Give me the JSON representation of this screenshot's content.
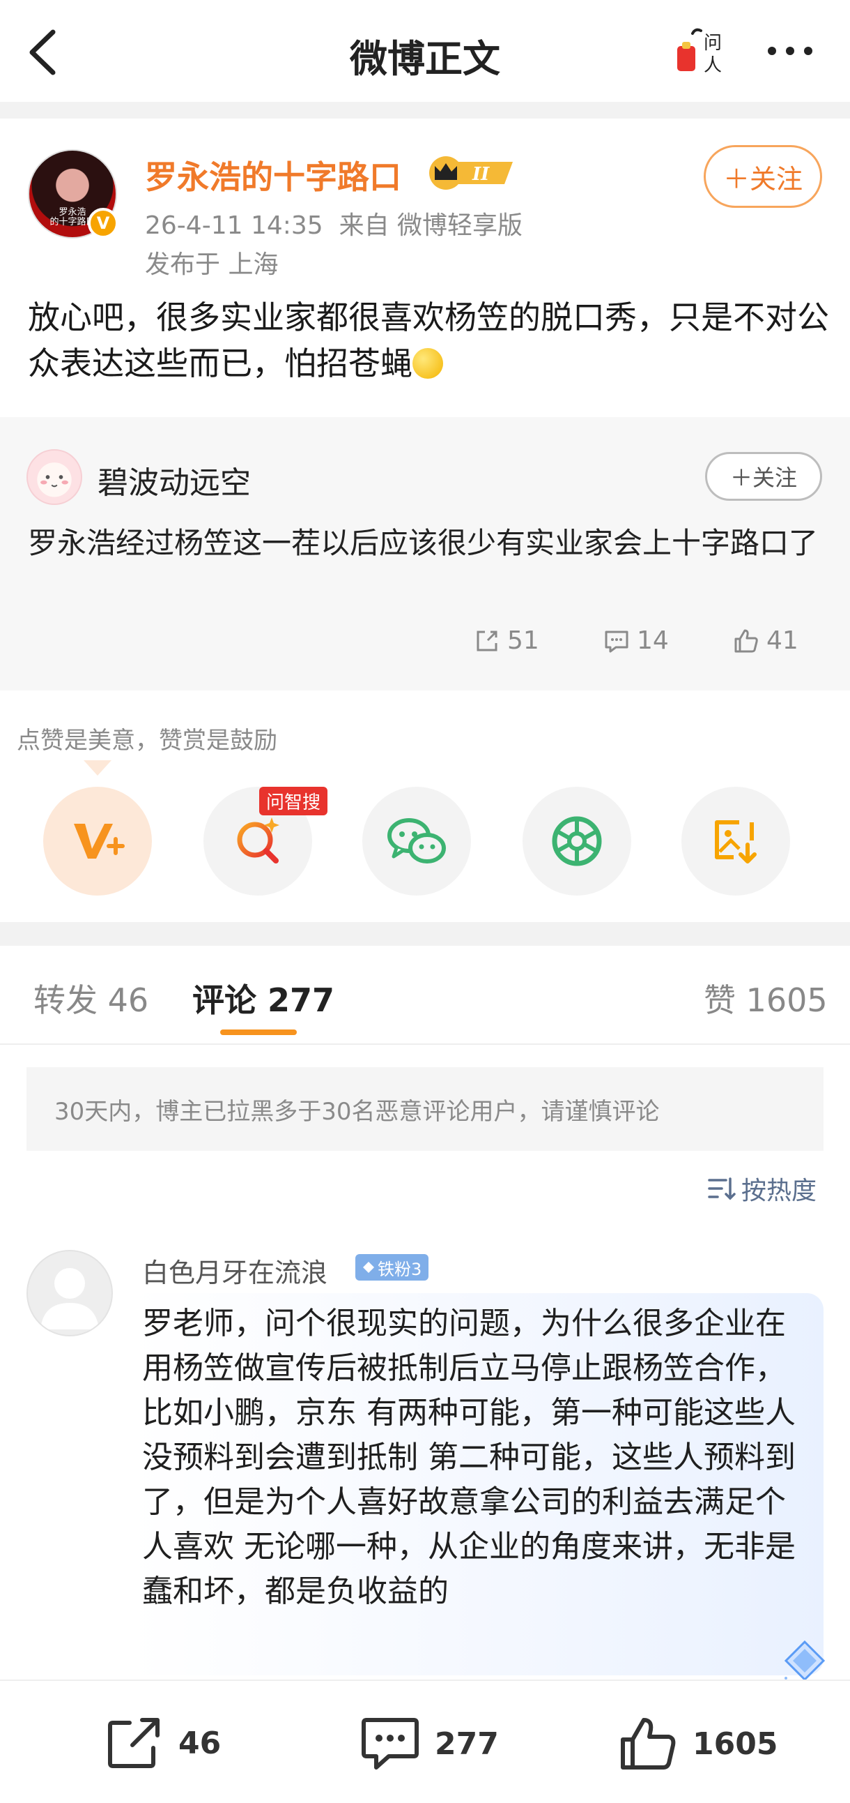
{
  "header": {
    "title": "微博正文",
    "ask_label": "问人"
  },
  "post": {
    "author": "罗永浩的十字路口",
    "avatar_caption": "罗永浩\n的十字路口",
    "level_badge": "II",
    "timestamp": "26-4-11 14:35",
    "source": "来自 微博轻享版",
    "location": "发布于 上海",
    "follow_label": "＋关注",
    "text": "放心吧，很多实业家都很喜欢杨笠的脱口秀，只是不对公众表达这些而已，怕招苍蝇"
  },
  "quoted": {
    "author": "碧波动远空",
    "follow_label": "＋关注",
    "text": "罗永浩经过杨笠这一茬以后应该很少有实业家会上十字路口了",
    "reposts": "51",
    "comments": "14",
    "likes": "41"
  },
  "tip": {
    "text": "点赞是美意，赞赏是鼓励",
    "ai_tag": "问智搜"
  },
  "share": [
    {
      "name": "reward",
      "icon": "v-plus-icon"
    },
    {
      "name": "ai-search",
      "icon": "search-sparkle-icon"
    },
    {
      "name": "wechat",
      "icon": "wechat-icon"
    },
    {
      "name": "moments",
      "icon": "camera-aperture-icon"
    },
    {
      "name": "save-image",
      "icon": "image-download-icon"
    }
  ],
  "tabs": {
    "repost": "转发 46",
    "comment": "评论 277",
    "like": "赞 1605"
  },
  "notice": "30天内，博主已拉黑多于30名恶意评论用户，请谨慎评论",
  "sort_label": "按热度",
  "comment": {
    "author": "白色月牙在流浪",
    "fan_badge": "铁粉3",
    "text": "罗老师，问个很现实的问题，为什么很多企业在用杨笠做宣传后被抵制后立马停止跟杨笠合作，比如小鹏，京东 有两种可能，第一种可能这些人没预料到会遭到抵制 第二种可能，这些人预料到了，但是为个人喜好故意拿公司的利益去满足个人喜欢  无论哪一种，从企业的角度来讲，无非是蠢和坏，都是负收益的"
  },
  "bottom_bar": {
    "reposts": "46",
    "comments": "277",
    "likes": "1605"
  },
  "colors": {
    "brand_orange": "#f07a2a",
    "tab_indicator": "#f7931e",
    "ai_tag_red": "#e8332d",
    "wechat_green": "#3cb371",
    "fan_badge_blue": "#7faee9"
  }
}
